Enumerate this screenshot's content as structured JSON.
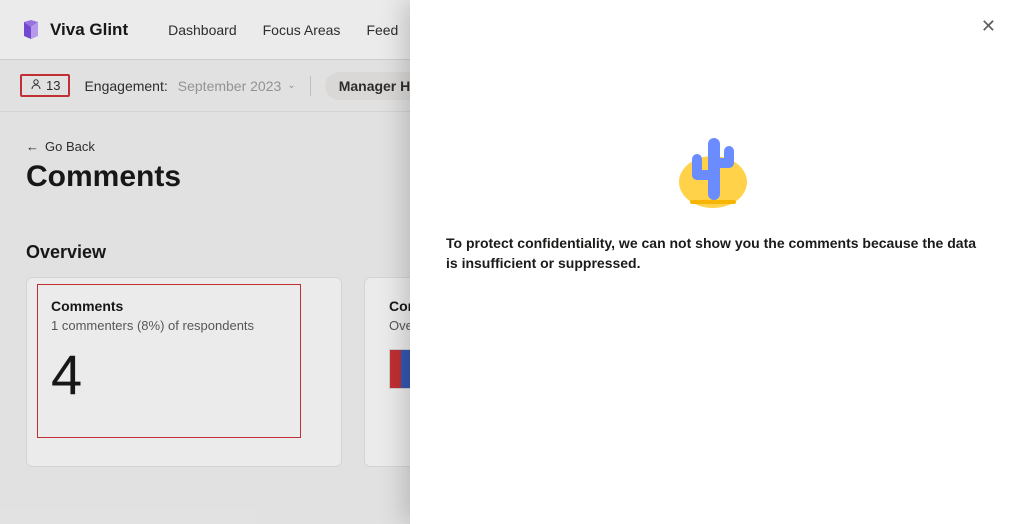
{
  "header": {
    "app_name": "Viva Glint",
    "nav": [
      "Dashboard",
      "Focus Areas",
      "Feed"
    ]
  },
  "filterbar": {
    "respondents_count": "13",
    "engagement_label": "Engagement:",
    "engagement_value": "September 2023",
    "hierarchy_label": "Manager Hierarchy:"
  },
  "main": {
    "go_back": "Go Back",
    "page_title": "Comments",
    "overview_title": "Overview"
  },
  "cards": {
    "comments": {
      "title": "Comments",
      "subtitle": "1 commenters (8%) of respondents",
      "value": "4"
    },
    "sentiment": {
      "title": "Comm",
      "subtitle": "Overall"
    }
  },
  "panel": {
    "message": "To protect confidentiality, we can not show you the comments because the data is insufficient or suppressed."
  }
}
